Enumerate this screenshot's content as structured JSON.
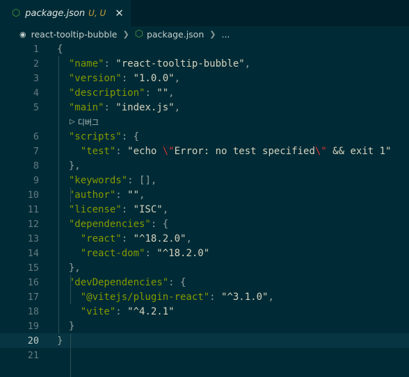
{
  "tab": {
    "filename": "package.json",
    "status": "U, U",
    "close": "✕"
  },
  "breadcrumb": {
    "folder": "react-tooltip-bubble",
    "file": "package.json",
    "more": "..."
  },
  "codelens": {
    "label": "디버그"
  },
  "lines": [
    [
      [
        "p",
        "{"
      ]
    ],
    [
      [
        "p",
        "  "
      ],
      [
        "k",
        "\"name\""
      ],
      [
        "p",
        ": "
      ],
      [
        "s",
        "\"react-tooltip-bubble\""
      ],
      [
        "p",
        ","
      ]
    ],
    [
      [
        "p",
        "  "
      ],
      [
        "k",
        "\"version\""
      ],
      [
        "p",
        ": "
      ],
      [
        "s",
        "\"1.0.0\""
      ],
      [
        "p",
        ","
      ]
    ],
    [
      [
        "p",
        "  "
      ],
      [
        "k",
        "\"description\""
      ],
      [
        "p",
        ": "
      ],
      [
        "s",
        "\"\""
      ],
      [
        "p",
        ","
      ]
    ],
    [
      [
        "p",
        "  "
      ],
      [
        "k",
        "\"main\""
      ],
      [
        "p",
        ": "
      ],
      [
        "s",
        "\"index.js\""
      ],
      [
        "p",
        ","
      ]
    ],
    [
      [
        "p",
        "  "
      ],
      [
        "k",
        "\"scripts\""
      ],
      [
        "p",
        ": {"
      ]
    ],
    [
      [
        "p",
        "    "
      ],
      [
        "k",
        "\"test\""
      ],
      [
        "p",
        ": "
      ],
      [
        "s",
        "\"echo "
      ],
      [
        "esc",
        "\\\""
      ],
      [
        "s",
        "Error: no test specified"
      ],
      [
        "esc",
        "\\\""
      ],
      [
        "s",
        " && exit 1\""
      ]
    ],
    [
      [
        "p",
        "  },"
      ]
    ],
    [
      [
        "p",
        "  "
      ],
      [
        "k",
        "\"keywords\""
      ],
      [
        "p",
        ": [],"
      ]
    ],
    [
      [
        "p",
        "  "
      ],
      [
        "k",
        "\"author\""
      ],
      [
        "p",
        ": "
      ],
      [
        "s",
        "\"\""
      ],
      [
        "p",
        ","
      ]
    ],
    [
      [
        "p",
        "  "
      ],
      [
        "k",
        "\"license\""
      ],
      [
        "p",
        ": "
      ],
      [
        "s",
        "\"ISC\""
      ],
      [
        "p",
        ","
      ]
    ],
    [
      [
        "p",
        "  "
      ],
      [
        "k",
        "\"dependencies\""
      ],
      [
        "p",
        ": {"
      ]
    ],
    [
      [
        "p",
        "    "
      ],
      [
        "k",
        "\"react\""
      ],
      [
        "p",
        ": "
      ],
      [
        "s",
        "\"^18.2.0\""
      ],
      [
        "p",
        ","
      ]
    ],
    [
      [
        "p",
        "    "
      ],
      [
        "k",
        "\"react-dom\""
      ],
      [
        "p",
        ": "
      ],
      [
        "s",
        "\"^18.2.0\""
      ]
    ],
    [
      [
        "p",
        "  },"
      ]
    ],
    [
      [
        "p",
        "  "
      ],
      [
        "k",
        "\"devDependencies\""
      ],
      [
        "p",
        ": {"
      ]
    ],
    [
      [
        "p",
        "    "
      ],
      [
        "k",
        "\"@vitejs/plugin-react\""
      ],
      [
        "p",
        ": "
      ],
      [
        "s",
        "\"^3.1.0\""
      ],
      [
        "p",
        ","
      ]
    ],
    [
      [
        "p",
        "    "
      ],
      [
        "k",
        "\"vite\""
      ],
      [
        "p",
        ": "
      ],
      [
        "s",
        "\"^4.2.1\""
      ]
    ],
    [
      [
        "p",
        "  }"
      ]
    ],
    [
      [
        "p",
        "}"
      ]
    ],
    []
  ],
  "line_numbers": [
    "1",
    "2",
    "3",
    "4",
    "5",
    "6",
    "7",
    "8",
    "9",
    "10",
    "11",
    "12",
    "13",
    "14",
    "15",
    "16",
    "17",
    "18",
    "19",
    "20",
    "21"
  ],
  "current_line": 20,
  "colors": {
    "background": "#002b36",
    "key": "#859900",
    "string": "#d6d2bd",
    "escape": "#dc322f",
    "file_icon": "#4f9a3c",
    "modified": "#c9a13a"
  }
}
